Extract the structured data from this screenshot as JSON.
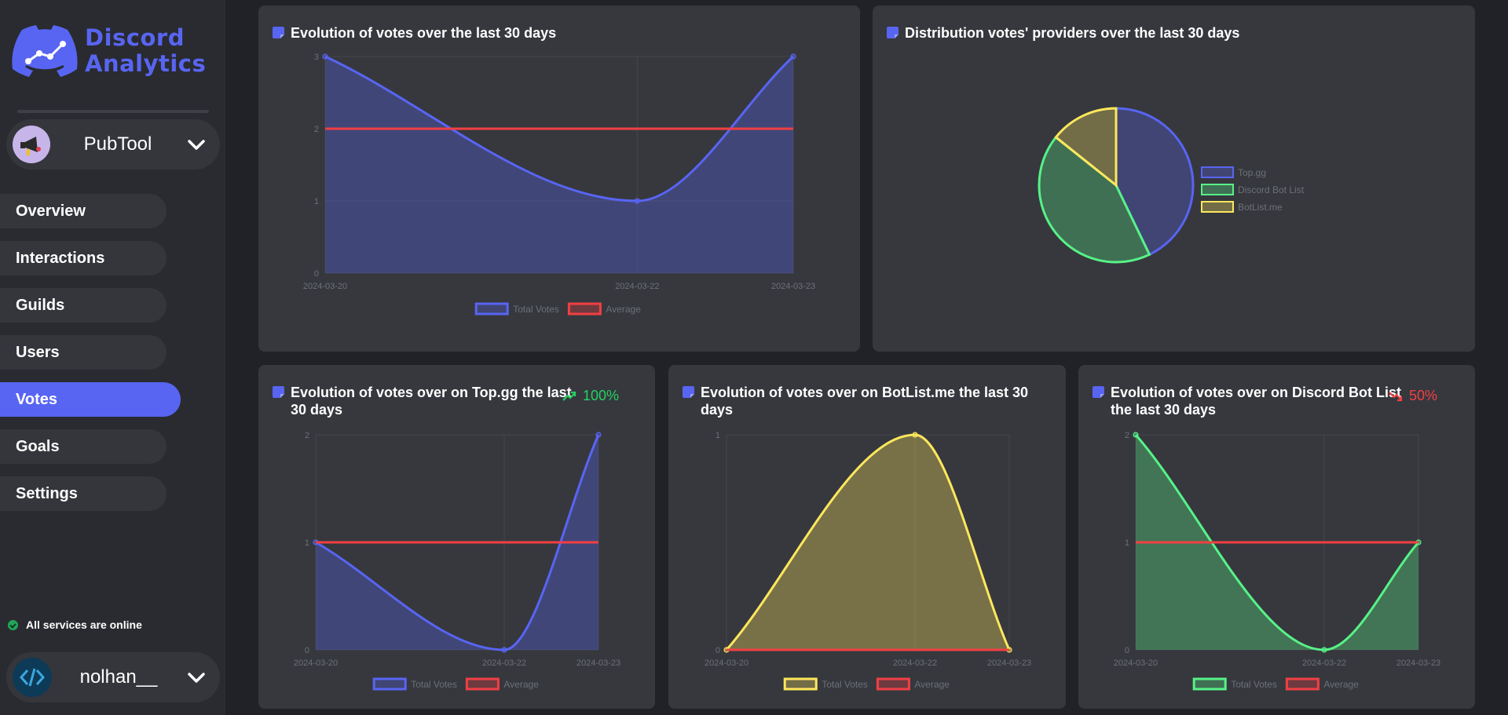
{
  "app": {
    "logo_line1": "Discord",
    "logo_line2": "Analytics",
    "brand_color": "#5865f2"
  },
  "bot_selector": {
    "name": "PubTool"
  },
  "nav": {
    "items": [
      {
        "label": "Overview",
        "active": false
      },
      {
        "label": "Interactions",
        "active": false
      },
      {
        "label": "Guilds",
        "active": false
      },
      {
        "label": "Users",
        "active": false
      },
      {
        "label": "Votes",
        "active": true
      },
      {
        "label": "Goals",
        "active": false
      },
      {
        "label": "Settings",
        "active": false
      }
    ]
  },
  "status": {
    "text": "All services are online",
    "color": "#23a55a"
  },
  "user": {
    "name": "nolhan__"
  },
  "cards": {
    "votes_total": {
      "title": "Evolution of votes over the last 30 days"
    },
    "providers": {
      "title": "Distribution votes' providers over the last 30 days"
    },
    "topgg": {
      "title_line1": "Evolution of votes over on Top.gg the last",
      "title_line2": "30 days",
      "trend": "100%"
    },
    "botlist": {
      "title_line1": "Evolution of votes over on BotList.me the last 30",
      "title_line2": "days"
    },
    "dbl": {
      "title_line1": "Evolution of votes over on Discord Bot List",
      "title_line2": "the last 30 days",
      "trend": "50%"
    }
  },
  "chart_data": [
    {
      "id": "votes_total",
      "type": "line",
      "x": [
        "2024-03-20",
        "2024-03-22",
        "2024-03-23"
      ],
      "series": [
        {
          "name": "Total Votes",
          "values": [
            3,
            1,
            3
          ],
          "color": "#5865f2",
          "fill": true
        },
        {
          "name": "Average",
          "values": [
            2,
            2,
            2
          ],
          "color": "#f23f43",
          "fill": false
        }
      ],
      "ylim": [
        0,
        3
      ],
      "yticks": [
        0,
        1,
        2,
        3
      ],
      "grid": true,
      "legend": "bottom"
    },
    {
      "id": "providers",
      "type": "pie",
      "labels": [
        "Top.gg",
        "Discord Bot List",
        "BotList.me"
      ],
      "values": [
        3,
        3,
        1
      ],
      "colors": [
        "#5865f2",
        "#57f287",
        "#fee75c"
      ],
      "legend": "right"
    },
    {
      "id": "topgg",
      "type": "line",
      "x": [
        "2024-03-20",
        "2024-03-22",
        "2024-03-23"
      ],
      "series": [
        {
          "name": "Total Votes",
          "values": [
            1,
            0,
            2
          ],
          "color": "#5865f2",
          "fill": true
        },
        {
          "name": "Average",
          "values": [
            1,
            1,
            1
          ],
          "color": "#f23f43",
          "fill": false
        }
      ],
      "ylim": [
        0,
        2
      ],
      "yticks": [
        0,
        1,
        2
      ],
      "grid": true,
      "legend": "bottom"
    },
    {
      "id": "botlist",
      "type": "line",
      "x": [
        "2024-03-20",
        "2024-03-22",
        "2024-03-23"
      ],
      "series": [
        {
          "name": "Total Votes",
          "values": [
            0,
            1,
            0
          ],
          "color": "#fee75c",
          "fill": true
        },
        {
          "name": "Average",
          "values": [
            0,
            0,
            0
          ],
          "color": "#f23f43",
          "fill": false
        }
      ],
      "ylim": [
        0,
        1
      ],
      "yticks": [
        0,
        1
      ],
      "grid": true,
      "legend": "bottom"
    },
    {
      "id": "dbl",
      "type": "line",
      "x": [
        "2024-03-20",
        "2024-03-22",
        "2024-03-23"
      ],
      "series": [
        {
          "name": "Total Votes",
          "values": [
            2,
            0,
            1
          ],
          "color": "#57f287",
          "fill": true
        },
        {
          "name": "Average",
          "values": [
            1,
            1,
            1
          ],
          "color": "#f23f43",
          "fill": false
        }
      ],
      "ylim": [
        0,
        2
      ],
      "yticks": [
        0,
        1,
        2
      ],
      "grid": true,
      "legend": "bottom"
    }
  ]
}
